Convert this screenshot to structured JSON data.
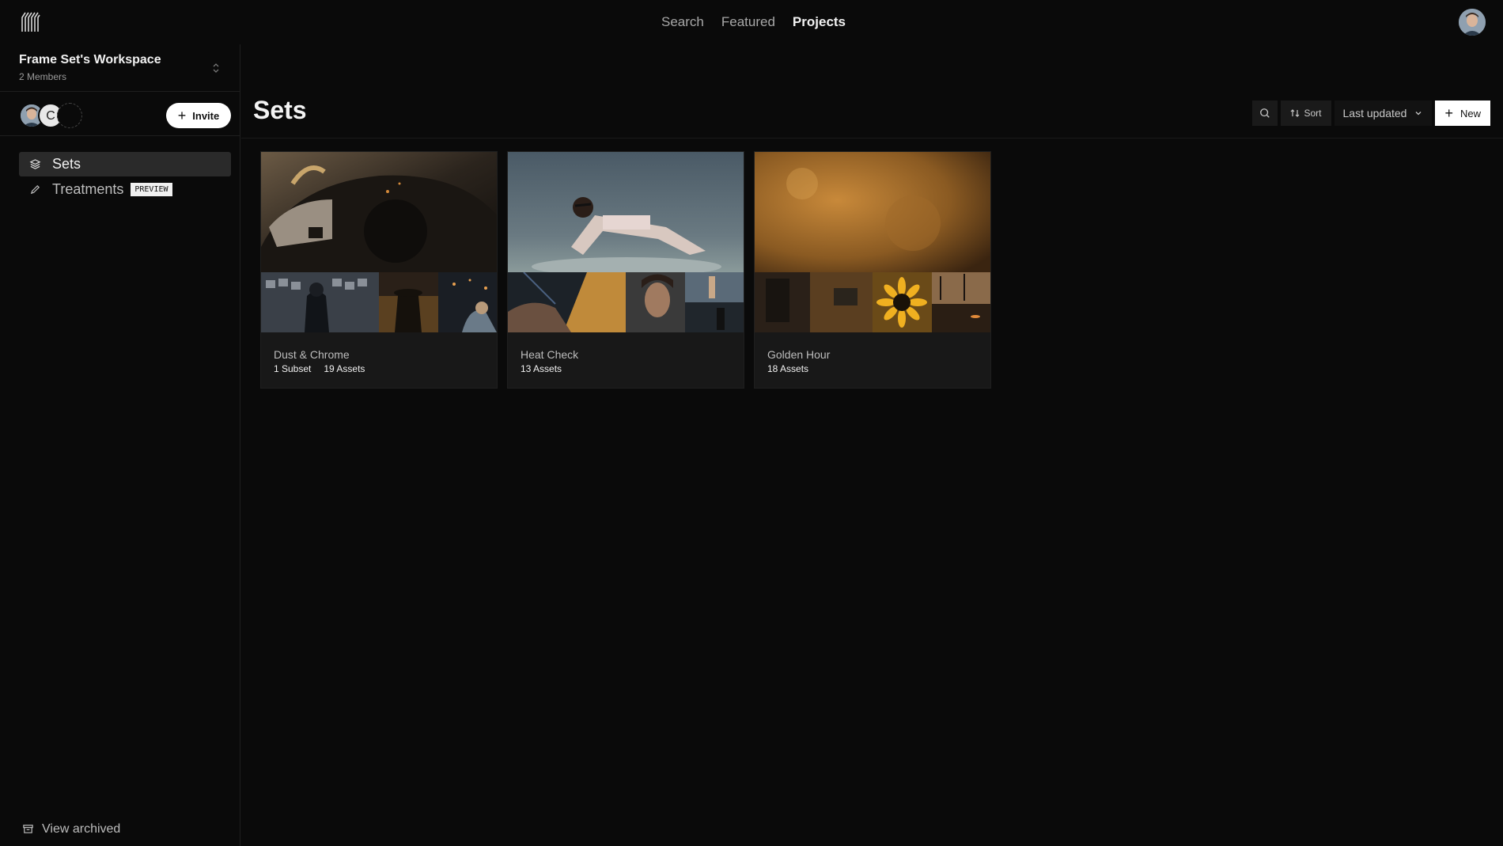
{
  "nav": {
    "items": [
      {
        "label": "Search",
        "active": false
      },
      {
        "label": "Featured",
        "active": false
      },
      {
        "label": "Projects",
        "active": true
      }
    ]
  },
  "workspace": {
    "name": "Frame Set's Workspace",
    "members": "2 Members",
    "member_initial": "C",
    "invite_label": "Invite"
  },
  "sidebar": {
    "items": [
      {
        "label": "Sets",
        "icon": "layers-icon",
        "active": true
      },
      {
        "label": "Treatments",
        "icon": "pencil-icon",
        "badge": "PREVIEW"
      }
    ],
    "archived_label": "View archived"
  },
  "main": {
    "title": "Sets",
    "sort_label": "Sort",
    "sort_value": "Last updated",
    "new_label": "New"
  },
  "sets": [
    {
      "title": "Dust & Chrome",
      "counts": [
        "1 Subset",
        "19 Assets"
      ]
    },
    {
      "title": "Heat Check",
      "counts": [
        "13 Assets"
      ]
    },
    {
      "title": "Golden Hour",
      "counts": [
        "18 Assets"
      ]
    }
  ],
  "colors": {
    "background": "#0a0a0a",
    "card": "#181818",
    "accent": "#ffffff"
  }
}
